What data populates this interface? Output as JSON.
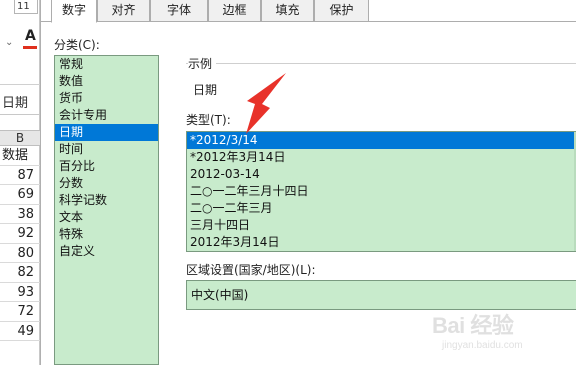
{
  "sheet": {
    "font_size": "11",
    "namebox": "日期",
    "column_letter": "B",
    "cells": [
      "数据",
      "87",
      "69",
      "38",
      "92",
      "80",
      "82",
      "93",
      "72",
      "49"
    ]
  },
  "dialog": {
    "tabs": [
      {
        "label": "数字",
        "active": true
      },
      {
        "label": "对齐",
        "active": false
      },
      {
        "label": "字体",
        "active": false
      },
      {
        "label": "边框",
        "active": false
      },
      {
        "label": "填充",
        "active": false
      },
      {
        "label": "保护",
        "active": false
      }
    ],
    "category_label": "分类(C):",
    "categories": [
      "常规",
      "数值",
      "货币",
      "会计专用",
      "日期",
      "时间",
      "百分比",
      "分数",
      "科学记数",
      "文本",
      "特殊",
      "自定义"
    ],
    "selected_category": "日期",
    "sample_title": "示例",
    "sample_value": "日期",
    "type_label": "类型(T):",
    "types": [
      "*2012/3/14",
      "*2012年3月14日",
      "2012-03-14",
      "二○一二年三月十四日",
      "二○一二年三月",
      "三月十四日",
      "2012年3月14日"
    ],
    "selected_type": "*2012/3/14",
    "locale_label": "区域设置(国家/地区)(L):",
    "locale_value": "中文(中国)"
  },
  "colors": {
    "list_bg": "#c8ebcc",
    "selection": "#0078d7",
    "arrow": "#e8322a"
  },
  "watermark": {
    "main": "Bai 经验",
    "sub": "jingyan.baidu.com"
  }
}
